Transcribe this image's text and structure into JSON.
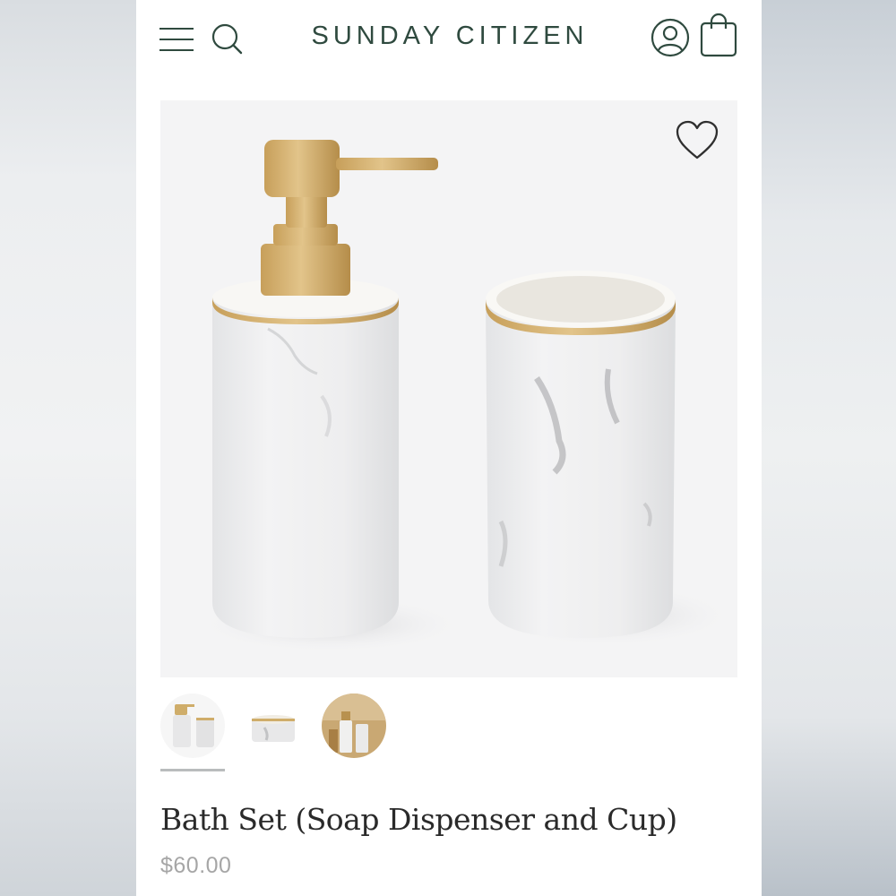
{
  "header": {
    "brand": "SUNDAY CITIZEN",
    "icons": [
      "menu-icon",
      "search-icon",
      "account-icon",
      "shopping-bag-icon"
    ]
  },
  "product": {
    "title": "Bath Set (Soap Dispenser and Cup)",
    "price": "$60.00",
    "selected_thumbnail": 1,
    "thumbnails": [
      "thumbnail-dispenser-and-cup",
      "thumbnail-cup",
      "thumbnail-lifestyle"
    ],
    "wishlist_icon": "heart-icon"
  },
  "colors": {
    "brand_green": "#2f4a3f",
    "gold_accent": "#c9a55c",
    "price_gray": "#a6a6a6"
  }
}
